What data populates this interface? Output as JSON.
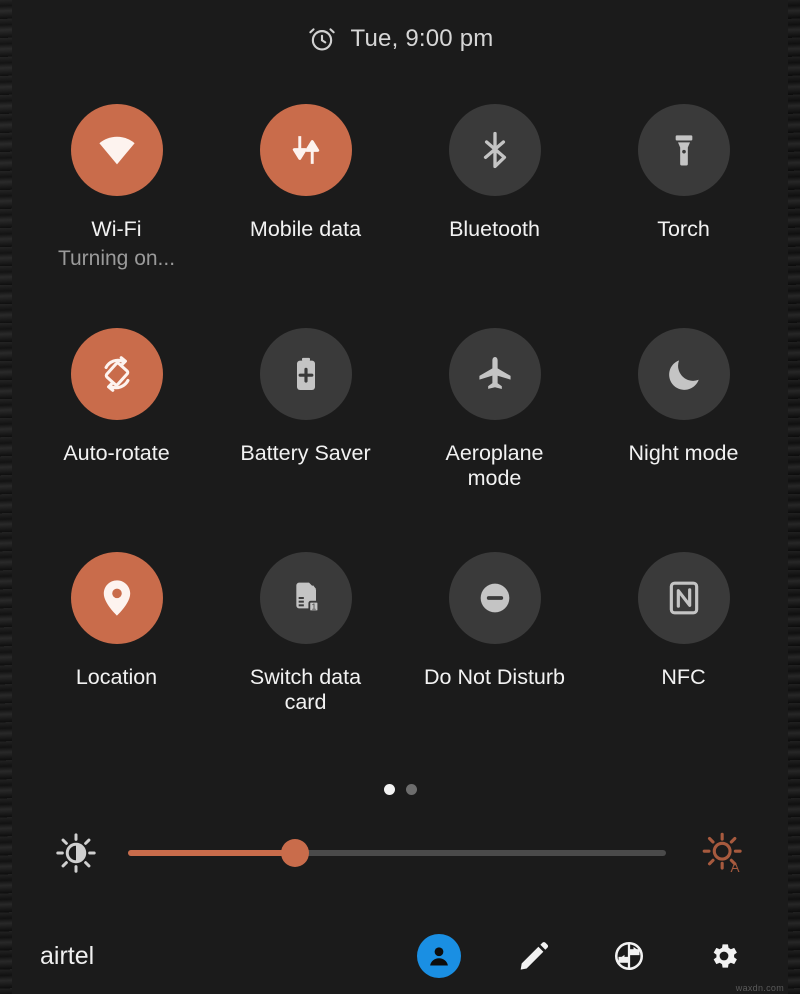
{
  "header": {
    "alarm_icon": "alarm-clock-icon",
    "time_text": "Tue, 9:00 pm"
  },
  "colors": {
    "accent_on": "#c96c4b",
    "tile_off": "#3a3a3a",
    "panel_bg": "#1b1b1b",
    "icon_off": "#c4c4c4",
    "icon_on": "#ffffff",
    "avatar_blue": "#1a8fe3",
    "sub_label": "#9a9a9a"
  },
  "tiles": [
    {
      "id": "wifi",
      "label": "Wi-Fi",
      "sub": "Turning on...",
      "state": "on",
      "icon": "wifi-icon"
    },
    {
      "id": "mobile-data",
      "label": "Mobile data",
      "sub": "",
      "state": "on",
      "icon": "mobile-data-icon"
    },
    {
      "id": "bluetooth",
      "label": "Bluetooth",
      "sub": "",
      "state": "off",
      "icon": "bluetooth-icon"
    },
    {
      "id": "torch",
      "label": "Torch",
      "sub": "",
      "state": "off",
      "icon": "flashlight-icon"
    },
    {
      "id": "auto-rotate",
      "label": "Auto-rotate",
      "sub": "",
      "state": "on",
      "icon": "auto-rotate-icon"
    },
    {
      "id": "battery-saver",
      "label": "Battery Saver",
      "sub": "",
      "state": "off",
      "icon": "battery-plus-icon"
    },
    {
      "id": "aeroplane-mode",
      "label": "Aeroplane mode",
      "sub": "",
      "state": "off",
      "icon": "airplane-icon"
    },
    {
      "id": "night-mode",
      "label": "Night mode",
      "sub": "",
      "state": "off",
      "icon": "moon-icon"
    },
    {
      "id": "location",
      "label": "Location",
      "sub": "",
      "state": "on",
      "icon": "location-pin-icon"
    },
    {
      "id": "switch-data-card",
      "label": "Switch data card",
      "sub": "",
      "state": "off",
      "icon": "sim-card-swap-icon"
    },
    {
      "id": "do-not-disturb",
      "label": "Do Not Disturb",
      "sub": "",
      "state": "off",
      "icon": "do-not-disturb-icon"
    },
    {
      "id": "nfc",
      "label": "NFC",
      "sub": "",
      "state": "off",
      "icon": "nfc-icon"
    }
  ],
  "pager": {
    "total_pages": 2,
    "current_page": 1
  },
  "brightness": {
    "left_icon": "brightness-contrast-icon",
    "right_icon": "auto-brightness-icon",
    "value_percent": 31
  },
  "footer": {
    "carrier": "airtel",
    "actions": [
      {
        "id": "user",
        "icon": "user-avatar-icon"
      },
      {
        "id": "edit",
        "icon": "pencil-edit-icon"
      },
      {
        "id": "power",
        "icon": "power-schedule-icon"
      },
      {
        "id": "settings",
        "icon": "gear-settings-icon"
      }
    ]
  },
  "watermark": "waxdn.com"
}
